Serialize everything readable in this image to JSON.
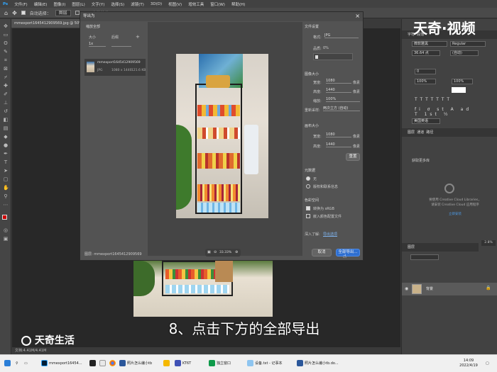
{
  "menu": [
    "文件(F)",
    "编辑(E)",
    "图像(I)",
    "图层(L)",
    "文字(Y)",
    "选择(S)",
    "滤镜(T)",
    "3D(D)",
    "视图(V)",
    "增效工具",
    "窗口(W)",
    "帮助(H)"
  ],
  "options": {
    "auto_select": "自动选择：",
    "group": "图层",
    "show_transform": "显示变换控件"
  },
  "doc_tab": "mmexport1645412909569.jpg @ 50%(RGB/8#)",
  "status": "文档:4.41M/4.41M",
  "dialog": {
    "title": "导出为",
    "close": "×",
    "left_header": "缩放全部",
    "size_label": "大小",
    "suffix_label": "后缀",
    "size_value": "1x",
    "suffix_value": "",
    "add": "+",
    "asset_name": "mmexport1645412909569",
    "asset_format": "JPG",
    "asset_dims": "1080 x 1440",
    "asset_size": "121.6 KB",
    "file_settings": "文件设置",
    "format_label": "格式:",
    "format_value": "JPG",
    "quality_label": "品质:",
    "quality_value": "0%",
    "image_size": "图像大小",
    "width_label": "宽度:",
    "width_value": "1080",
    "height_label": "高度:",
    "height_value": "1440",
    "unit": "像素",
    "scale_label": "缩放:",
    "scale_value": "100%",
    "resample_label": "重新采样:",
    "resample_value": "两次立方 (自动)",
    "canvas_size": "画布大小",
    "canvas_width_value": "1080",
    "canvas_height_value": "1440",
    "reset": "重置",
    "metadata": "元数据",
    "meta_none": "无",
    "meta_copyright": "版权和联系信息",
    "color_space": "色彩空间",
    "convert_srgb": "转换为 sRGB",
    "embed_profile": "嵌入颜色配置文件",
    "learn_more": "深入了解:",
    "export_options": "导出选项",
    "bottom_name": "图层: mmexport1645412909569",
    "zoom": "33.33%",
    "cancel": "取消",
    "export_all": "全部导出..."
  },
  "right_panel": {
    "character": "字符",
    "paragraph": "段落",
    "font_style": "Regular",
    "font_family": "微软雅黑",
    "size": "36.64 点",
    "leading": "(自动)",
    "tracking": "0",
    "scale_v": "100%",
    "scale_h": "100%",
    "language": "美国英语",
    "layers_tab": "图层",
    "channels_tab": "通道",
    "paths_tab": "路径",
    "libraries": "获取更多库",
    "cc_text_1": "要使用 Creative Cloud Libraries，",
    "cc_text_2": "请安装 Creative Cloud 应用程序",
    "cc_link": "立即安装",
    "layer_name": "背景",
    "zoom_chip": "2.8%"
  },
  "caption": "8、点击下方的全部导出",
  "watermark_top": "天奇·视频",
  "watermark_bottom": "天奇生活",
  "taskbar": {
    "items": [
      "mmexport16454...",
      "照片怎么编小tb",
      "KT6T",
      "独立窗口",
      "设备.txt - 记事本",
      "照片怎么编小tb.do..."
    ],
    "time": "14:09",
    "date": "2022/4/19"
  }
}
